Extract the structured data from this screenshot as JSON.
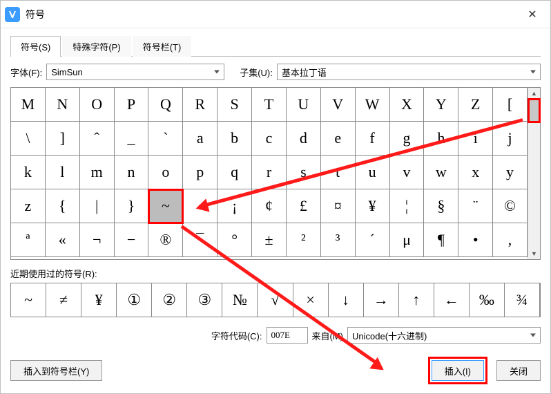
{
  "titlebar": {
    "title": "符号"
  },
  "tabs": [
    {
      "label": "符号(S)",
      "active": true
    },
    {
      "label": "特殊字符(P)",
      "active": false
    },
    {
      "label": "符号栏(T)",
      "active": false
    }
  ],
  "font": {
    "label": "字体(F):",
    "value": "SimSun"
  },
  "subset": {
    "label": "子集(U):",
    "value": "基本拉丁语"
  },
  "grid": [
    [
      "M",
      "N",
      "O",
      "P",
      "Q",
      "R",
      "S",
      "T",
      "U",
      "V",
      "W",
      "X",
      "Y",
      "Z",
      "["
    ],
    [
      "\\",
      "]",
      "ˆ",
      "_",
      "ˋ",
      "a",
      "b",
      "c",
      "d",
      "e",
      "f",
      "g",
      "h",
      "i",
      "j"
    ],
    [
      "k",
      "l",
      "m",
      "n",
      "o",
      "p",
      "q",
      "r",
      "s",
      "t",
      "u",
      "v",
      "w",
      "x",
      "y"
    ],
    [
      "z",
      "{",
      "|",
      "}",
      "~",
      "",
      "¡",
      "¢",
      "£",
      "¤",
      "¥",
      "¦",
      "§",
      "¨",
      "©"
    ],
    [
      "ª",
      "«",
      "¬",
      "−",
      "®",
      "¯",
      "°",
      "±",
      "²",
      "³",
      "´",
      "μ",
      "¶",
      "•",
      ","
    ]
  ],
  "selected": {
    "row": 3,
    "col": 4
  },
  "recent": {
    "label": "近期使用过的符号(R):",
    "items": [
      "~",
      "≠",
      "¥",
      "①",
      "②",
      "③",
      "№",
      "√",
      "×",
      "↓",
      "→",
      "↑",
      "←",
      "‰",
      "¾"
    ]
  },
  "code": {
    "label": "字符代码(C):",
    "value": "007E",
    "from_label": "来自(M)",
    "from_value": "Unicode(十六进制)"
  },
  "footer": {
    "insert_bar": "插入到符号栏(Y)",
    "insert": "插入(I)",
    "close": "关闭"
  }
}
